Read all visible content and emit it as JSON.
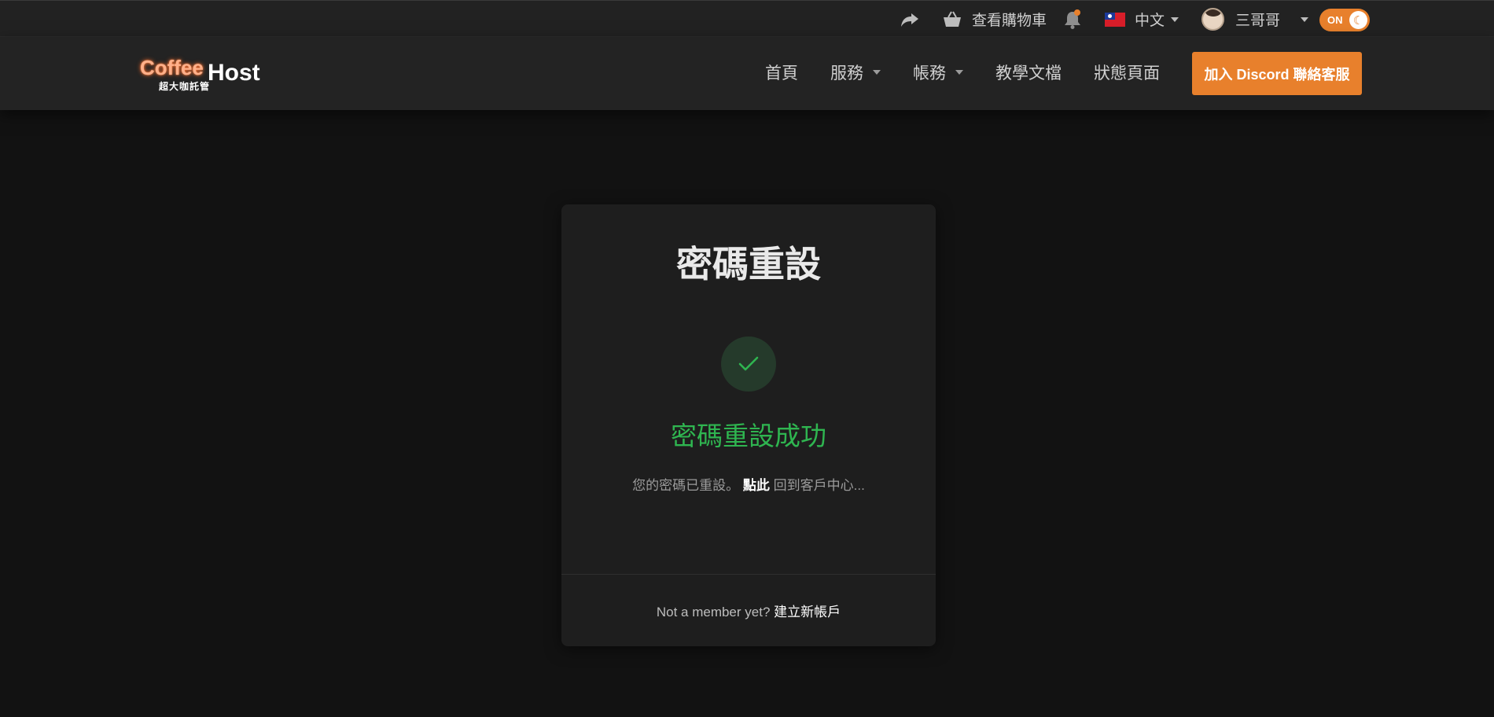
{
  "topbar": {
    "share_icon": "share-icon",
    "cart_icon": "basket-icon",
    "cart_label": "查看購物車",
    "bell_icon": "bell-icon",
    "language_flag": "taiwan-flag-icon",
    "language_label": "中文",
    "user_name": "三哥哥",
    "theme_toggle_label": "ON",
    "theme_toggle_icon": "moon-icon"
  },
  "navbar": {
    "logo_coffee": "Coffee",
    "logo_host": "Host",
    "logo_sub": "超大咖託管",
    "links": [
      {
        "label": "首頁"
      },
      {
        "label": "服務"
      },
      {
        "label": "帳務"
      },
      {
        "label": "教學文檔"
      },
      {
        "label": "狀態頁面"
      }
    ],
    "discord_button": "加入 Discord 聯絡客服"
  },
  "card": {
    "title": "密碼重設",
    "check_icon": "checkmark-icon",
    "success_text": "密碼重設成功",
    "info_prefix": "您的密碼已重設。",
    "info_click": "點此",
    "info_suffix": "回到客戶中心...",
    "footer_prefix": "Not a member yet?",
    "footer_link": "建立新帳戶"
  },
  "colors": {
    "accent": "#e8802c",
    "success": "#2fb550",
    "background": "#121212",
    "card": "#1e1e1e"
  }
}
